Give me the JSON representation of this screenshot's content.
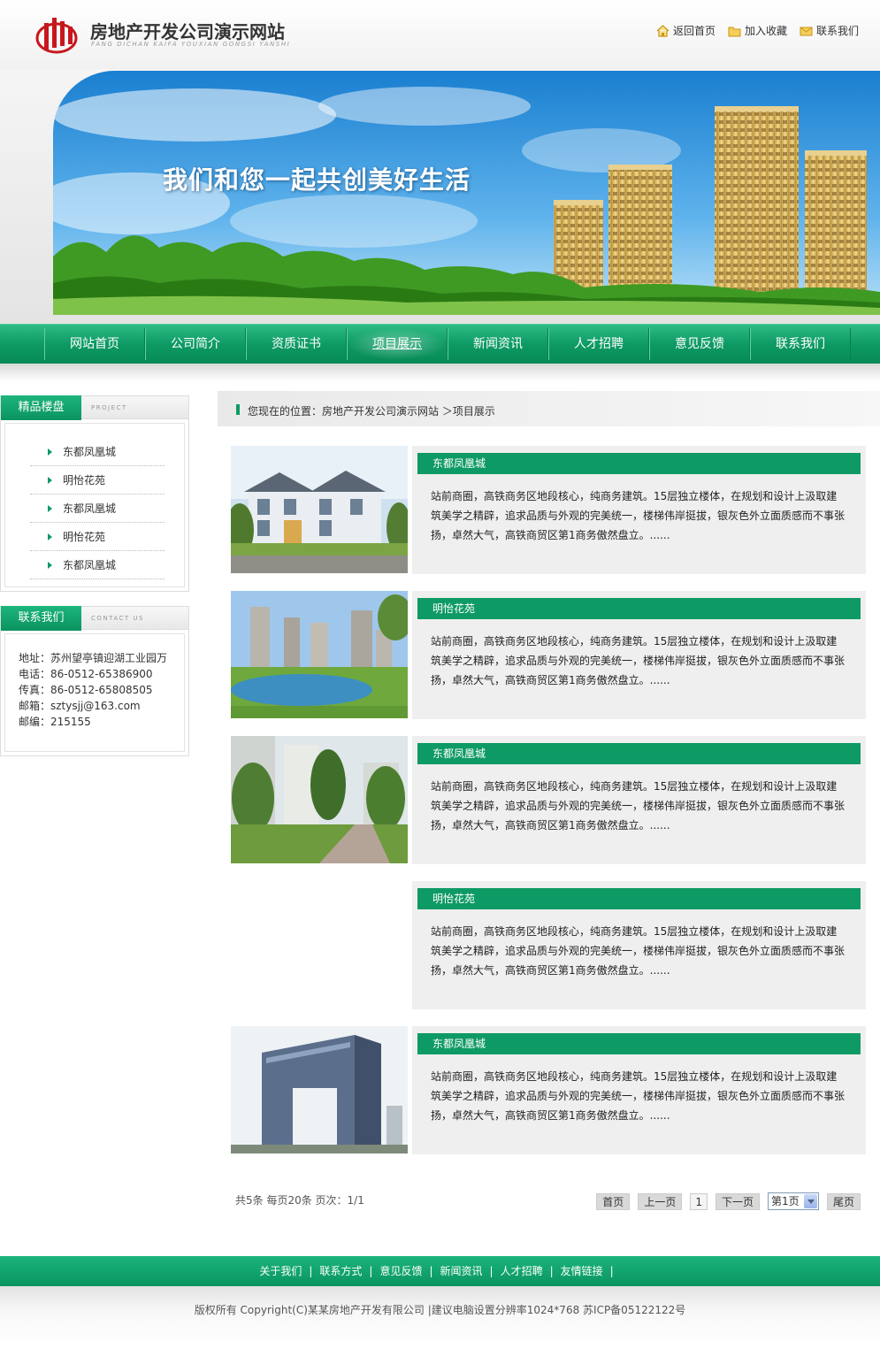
{
  "header": {
    "site_title": "房地产开发公司演示网站",
    "site_subtitle": "FANG DICHAN KAIFA YOUXIAN GONGSI YANSHI",
    "top_links": [
      {
        "label": "返回首页",
        "icon": "home-icon"
      },
      {
        "label": "加入收藏",
        "icon": "folder-icon"
      },
      {
        "label": "联系我们",
        "icon": "mail-icon"
      }
    ]
  },
  "banner": {
    "slogan": "我们和您一起共创美好生活"
  },
  "nav": {
    "items": [
      "网站首页",
      "公司简介",
      "资质证书",
      "项目展示",
      "新闻资讯",
      "人才招聘",
      "意见反馈",
      "联系我们"
    ],
    "active": "项目展示"
  },
  "sidebar": {
    "projects": {
      "title": "精品楼盘",
      "title_en": "PROJECT",
      "items": [
        "东都凤凰城",
        "明怡花苑",
        "东都凤凰城",
        "明怡花苑",
        "东都凤凰城"
      ]
    },
    "contact": {
      "title": "联系我们",
      "title_en": "CONTACT US",
      "lines": [
        "地址：苏州望亭镇迎湖工业园万",
        "电话：86-0512-65386900",
        "传真：86-0512-65808505",
        "邮箱：sztysjj@163.com",
        "邮编：215155"
      ]
    }
  },
  "breadcrumb": "您现在的位置：房地产开发公司演示网站 ＞项目展示",
  "projects": [
    {
      "title": "东都凤凰城",
      "image": "villa-photo",
      "desc": "站前商圈，高铁商务区地段核心，纯商务建筑。15层独立楼体，在规划和设计上汲取建筑美学之精辟，追求品质与外观的完美统一，楼梯伟岸挺拔，银灰色外立面质感而不事张扬，卓然大气，高铁商贸区第1商务傲然盘立。......"
    },
    {
      "title": "明怡花苑",
      "image": "lake-towers-photo",
      "desc": "站前商圈，高铁商务区地段核心，纯商务建筑。15层独立楼体，在规划和设计上汲取建筑美学之精辟，追求品质与外观的完美统一，楼梯伟岸挺拔，银灰色外立面质感而不事张扬，卓然大气，高铁商贸区第1商务傲然盘立。......"
    },
    {
      "title": "东都凤凰城",
      "image": "garden-path-photo",
      "desc": "站前商圈，高铁商务区地段核心，纯商务建筑。15层独立楼体，在规划和设计上汲取建筑美学之精辟，追求品质与外观的完美统一，楼梯伟岸挺拔，银灰色外立面质感而不事张扬，卓然大气，高铁商贸区第1商务傲然盘立。......"
    },
    {
      "title": "明怡花苑",
      "image": "",
      "desc": "站前商圈，高铁商务区地段核心，纯商务建筑。15层独立楼体，在规划和设计上汲取建筑美学之精辟，追求品质与外观的完美统一，楼梯伟岸挺拔，银灰色外立面质感而不事张扬，卓然大气，高铁商贸区第1商务傲然盘立。......"
    },
    {
      "title": "东都凤凰城",
      "image": "office-arch-photo",
      "desc": "站前商圈，高铁商务区地段核心，纯商务建筑。15层独立楼体，在规划和设计上汲取建筑美学之精辟，追求品质与外观的完美统一，楼梯伟岸挺拔，银灰色外立面质感而不事张扬，卓然大气，高铁商贸区第1商务傲然盘立。......"
    }
  ],
  "pager": {
    "info": "共5条  每页20条  页次：1/1",
    "first": "首页",
    "prev": "上一页",
    "current": "1",
    "next": "下一页",
    "select_value": "第1页",
    "last": "尾页"
  },
  "footer": {
    "links": [
      "关于我们",
      "联系方式",
      "意见反馈",
      "新闻资讯",
      "人才招聘",
      "友情链接"
    ],
    "separator": "|",
    "copyright": "版权所有  Copyright(C)某某房地产开发有限公司   |建议电脑设置分辨率1024*768 苏ICP备05122122号"
  },
  "colors": {
    "brand_green": "#0e9a64",
    "logo_red": "#c8161d"
  }
}
